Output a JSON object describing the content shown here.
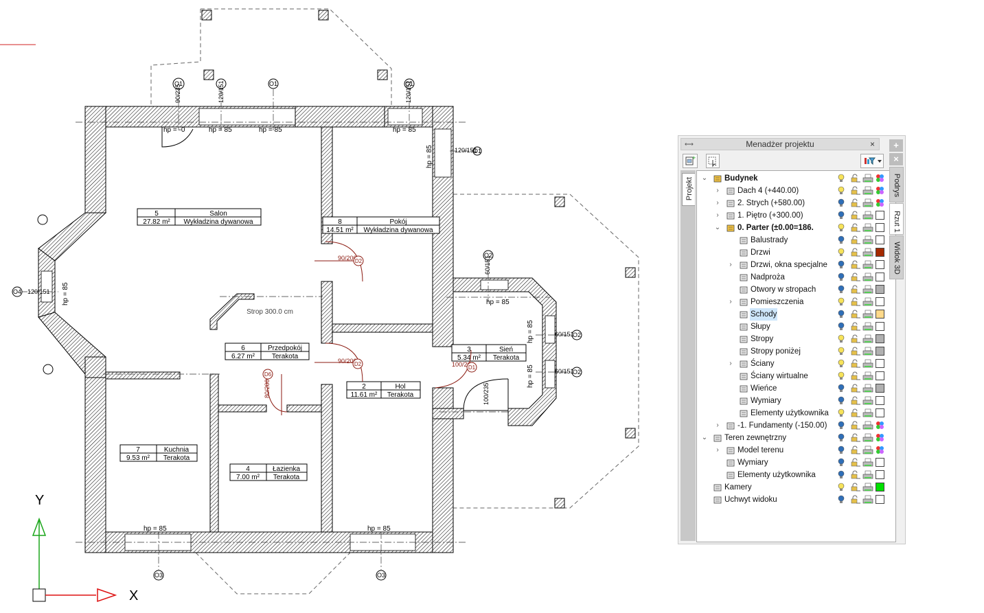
{
  "drawing": {
    "rooms": [
      {
        "num": "5",
        "name": "Salon",
        "area": "27.82 m²",
        "finish": "Wykładzina dywanowa"
      },
      {
        "num": "8",
        "name": "Pokój",
        "area": "14.51 m²",
        "finish": "Wykładzina dywanowa"
      },
      {
        "num": "6",
        "name": "Przedpokój",
        "area": "6.27 m²",
        "finish": "Terakota"
      },
      {
        "num": "3",
        "name": "Sień",
        "area": "5.34 m²",
        "finish": "Terakota"
      },
      {
        "num": "2",
        "name": "Hol",
        "area": "11.61 m²",
        "finish": "Terakota"
      },
      {
        "num": "7",
        "name": "Kuchnia",
        "area": "9.53 m²",
        "finish": "Terakota"
      },
      {
        "num": "4",
        "name": "Łazienka",
        "area": "7.00 m²",
        "finish": "Terakota"
      }
    ],
    "ceiling_label": "Strop 300.0 cm",
    "hp_label": "hp = 85",
    "hp_zero": "hp = -0",
    "window_tags": [
      "O1",
      "O1",
      "O1",
      "O1",
      "O2",
      "O2",
      "O2",
      "O3",
      "O3",
      "O4"
    ],
    "door_tags": [
      "D2",
      "D2",
      "D1",
      "D6"
    ],
    "door_dims": [
      "90/200",
      "90/200",
      "100/200",
      "80/200",
      "100/235"
    ],
    "window_dims": [
      "120/151",
      "120/151",
      "120/151",
      "120/151",
      "60/151",
      "60/151",
      "60/151",
      "90/235"
    ],
    "axis_labels": {
      "y": "Y",
      "x": "X"
    }
  },
  "panel": {
    "title": "Menadżer projektu",
    "tab_left": "Projekt",
    "right_tabs": [
      "Podrys",
      "Rzut 1",
      "Widok 3D"
    ],
    "plus": "+",
    "x": "×",
    "tree": [
      {
        "label": "Budynek",
        "bold": true,
        "level": 0,
        "expand": "v",
        "swatch": "multi",
        "icon": "building-icon",
        "bulb": "yellow"
      },
      {
        "label": "Dach 4 (+440.00)",
        "level": 1,
        "expand": ">",
        "swatch": "multi",
        "icon": "roof-icon",
        "bulb": "yellow"
      },
      {
        "label": "2. Strych (+580.00)",
        "level": 1,
        "expand": ">",
        "swatch": "multi",
        "icon": "floor-icon",
        "bulb": "blue"
      },
      {
        "label": "1. Piętro (+300.00)",
        "level": 1,
        "expand": ">",
        "swatch": "#ffffff",
        "icon": "floor-icon",
        "bulb": "blue"
      },
      {
        "label": "0. Parter (±0.00=186.",
        "bold": true,
        "level": 1,
        "expand": "v",
        "swatch": "#ffffff",
        "icon": "active-floor-icon",
        "bulb": "yellow"
      },
      {
        "label": "Balustrady",
        "level": 2,
        "expand": "",
        "swatch": "#ffffff",
        "icon": "railing-icon",
        "bulb": "blue"
      },
      {
        "label": "Drzwi",
        "level": 2,
        "expand": "",
        "swatch": "#a52a00",
        "icon": "door-icon",
        "bulb": "yellow"
      },
      {
        "label": "Drzwi, okna specjalne",
        "level": 2,
        "expand": ">",
        "swatch": "#ffffff",
        "icon": "special-door-icon",
        "bulb": "blue"
      },
      {
        "label": "Nadproża",
        "level": 2,
        "expand": "",
        "swatch": "#ffffff",
        "icon": "lintel-icon",
        "bulb": "blue"
      },
      {
        "label": "Otwory w stropach",
        "level": 2,
        "expand": "",
        "swatch": "#b0b0b0",
        "icon": "opening-icon",
        "bulb": "blue"
      },
      {
        "label": "Pomieszczenia",
        "level": 2,
        "expand": ">",
        "swatch": "#ffffff",
        "icon": "room-icon",
        "bulb": "yellow"
      },
      {
        "label": "Schody",
        "level": 2,
        "expand": "",
        "swatch": "#ffd98a",
        "icon": "stairs-icon",
        "bulb": "blue",
        "highlight": true
      },
      {
        "label": "Słupy",
        "level": 2,
        "expand": "",
        "swatch": "#ffffff",
        "icon": "column-icon",
        "bulb": "blue"
      },
      {
        "label": "Stropy",
        "level": 2,
        "expand": "",
        "swatch": "#b0b0b0",
        "icon": "slab-icon",
        "bulb": "yellow"
      },
      {
        "label": "Stropy poniżej",
        "level": 2,
        "expand": "",
        "swatch": "#b0b0b0",
        "icon": "slab-below-icon",
        "bulb": "yellow"
      },
      {
        "label": "Ściany",
        "level": 2,
        "expand": ">",
        "swatch": "#ffffff",
        "icon": "wall-icon",
        "bulb": "yellow"
      },
      {
        "label": "Ściany wirtualne",
        "level": 2,
        "expand": "",
        "swatch": "#ffffff",
        "icon": "virtual-wall-icon",
        "bulb": "yellow"
      },
      {
        "label": "Wieńce",
        "level": 2,
        "expand": "",
        "swatch": "#b0b0b0",
        "icon": "ring-beam-icon",
        "bulb": "blue"
      },
      {
        "label": "Wymiary",
        "level": 2,
        "expand": "",
        "swatch": "#ffffff",
        "icon": "dimension-icon",
        "bulb": "blue"
      },
      {
        "label": "Elementy użytkownika",
        "level": 2,
        "expand": "",
        "swatch": "#ffffff",
        "icon": "user-elements-icon",
        "bulb": "yellow"
      },
      {
        "label": "-1. Fundamenty (-150.00)",
        "level": 1,
        "expand": ">",
        "swatch": "multi",
        "icon": "floor-icon",
        "bulb": "blue"
      },
      {
        "label": "Teren zewnętrzny",
        "level": 0,
        "expand": "v",
        "swatch": "multi",
        "icon": "terrain-icon",
        "bulb": "blue"
      },
      {
        "label": "Model terenu",
        "level": 1,
        "expand": ">",
        "swatch": "multi",
        "icon": "terrain-model-icon",
        "bulb": "blue"
      },
      {
        "label": "Wymiary",
        "level": 1,
        "expand": "",
        "swatch": "#ffffff",
        "icon": "dimension-icon",
        "bulb": "blue"
      },
      {
        "label": "Elementy użytkownika",
        "level": 1,
        "expand": "",
        "swatch": "#ffffff",
        "icon": "user-elements-icon",
        "bulb": "blue"
      },
      {
        "label": "Kamery",
        "level": 0,
        "expand": "",
        "swatch": "#00e000",
        "icon": "camera-icon",
        "bulb": "yellow"
      },
      {
        "label": "Uchwyt widoku",
        "level": 0,
        "expand": "",
        "swatch": "#ffffff",
        "icon": "view-handle-icon",
        "bulb": "blue"
      }
    ]
  }
}
